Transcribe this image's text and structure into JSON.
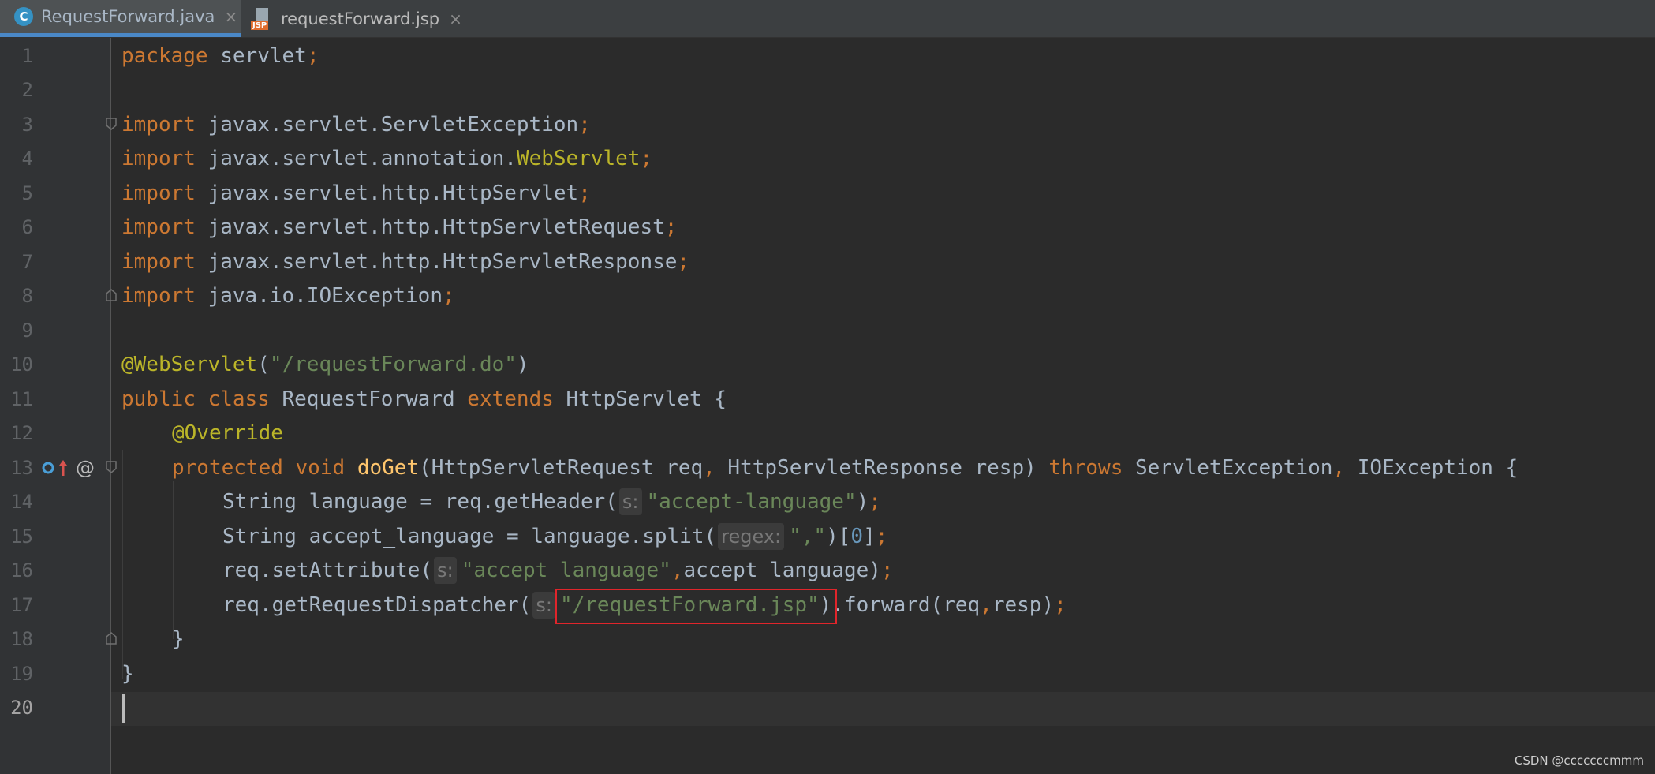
{
  "tabs": [
    {
      "label": "RequestForward.java",
      "icon": "java-class-icon",
      "icon_glyph": "C",
      "active": true
    },
    {
      "label": "requestForward.jsp",
      "icon": "jsp-file-icon",
      "icon_glyph": "JSP",
      "active": false
    }
  ],
  "close_glyph": "×",
  "editor": {
    "current_line": 20,
    "lines": [
      {
        "n": "1"
      },
      {
        "n": "2"
      },
      {
        "n": "3"
      },
      {
        "n": "4"
      },
      {
        "n": "5"
      },
      {
        "n": "6"
      },
      {
        "n": "7"
      },
      {
        "n": "8"
      },
      {
        "n": "9"
      },
      {
        "n": "10"
      },
      {
        "n": "11"
      },
      {
        "n": "12"
      },
      {
        "n": "13"
      },
      {
        "n": "14"
      },
      {
        "n": "15"
      },
      {
        "n": "16"
      },
      {
        "n": "17"
      },
      {
        "n": "18"
      },
      {
        "n": "19"
      },
      {
        "n": "20"
      }
    ],
    "code": {
      "l1": [
        "package",
        " servlet",
        ";"
      ],
      "l3": [
        "import",
        " javax.servlet.ServletException",
        ";"
      ],
      "l4": [
        "import",
        " javax.servlet.annotation.",
        "WebServlet",
        ";"
      ],
      "l5": [
        "import",
        " javax.servlet.http.HttpServlet",
        ";"
      ],
      "l6": [
        "import",
        " javax.servlet.http.HttpServletRequest",
        ";"
      ],
      "l7": [
        "import",
        " javax.servlet.http.HttpServletResponse",
        ";"
      ],
      "l8": [
        "import",
        " java.io.IOException",
        ";"
      ],
      "l10": [
        "@WebServlet",
        "(",
        "\"/requestForward.do\"",
        ")"
      ],
      "l11": [
        "public class",
        " RequestForward ",
        "extends",
        " HttpServlet {"
      ],
      "l12": [
        "@Override"
      ],
      "l13": [
        "protected void",
        " ",
        "doGet",
        "(HttpServletRequest req",
        ",",
        " HttpServletResponse resp) ",
        "throws",
        " ServletException",
        ",",
        " IOException {"
      ],
      "l14": [
        "String language = req.getHeader(",
        "s:",
        "\"accept-language\"",
        ")",
        ";"
      ],
      "l15": [
        "String accept_language = language.split(",
        "regex:",
        "\",\"",
        ")[",
        "0",
        "]",
        ";"
      ],
      "l16": [
        "req.setAttribute(",
        "s:",
        "\"accept_language\"",
        ",",
        "accept_language)",
        ";"
      ],
      "l17": [
        "req.getRequestDispatcher(",
        "s:",
        "\"/requestForward.jsp\"",
        ").forward(req",
        ",",
        "resp)",
        ";"
      ],
      "l18": [
        "}"
      ],
      "l19": [
        "}"
      ]
    },
    "gutter_icons": [
      "implementing-method-icon",
      "up-arrow-icon",
      "annotation-at-icon"
    ],
    "gutter_at": "@"
  },
  "watermark": "CSDN @cccccccmmm",
  "colors": {
    "keyword": "#cc7832",
    "string": "#6a8759",
    "annotation": "#bbb529",
    "number": "#6897bb",
    "method": "#ffc66d",
    "highlight_box": "#e0252b"
  }
}
